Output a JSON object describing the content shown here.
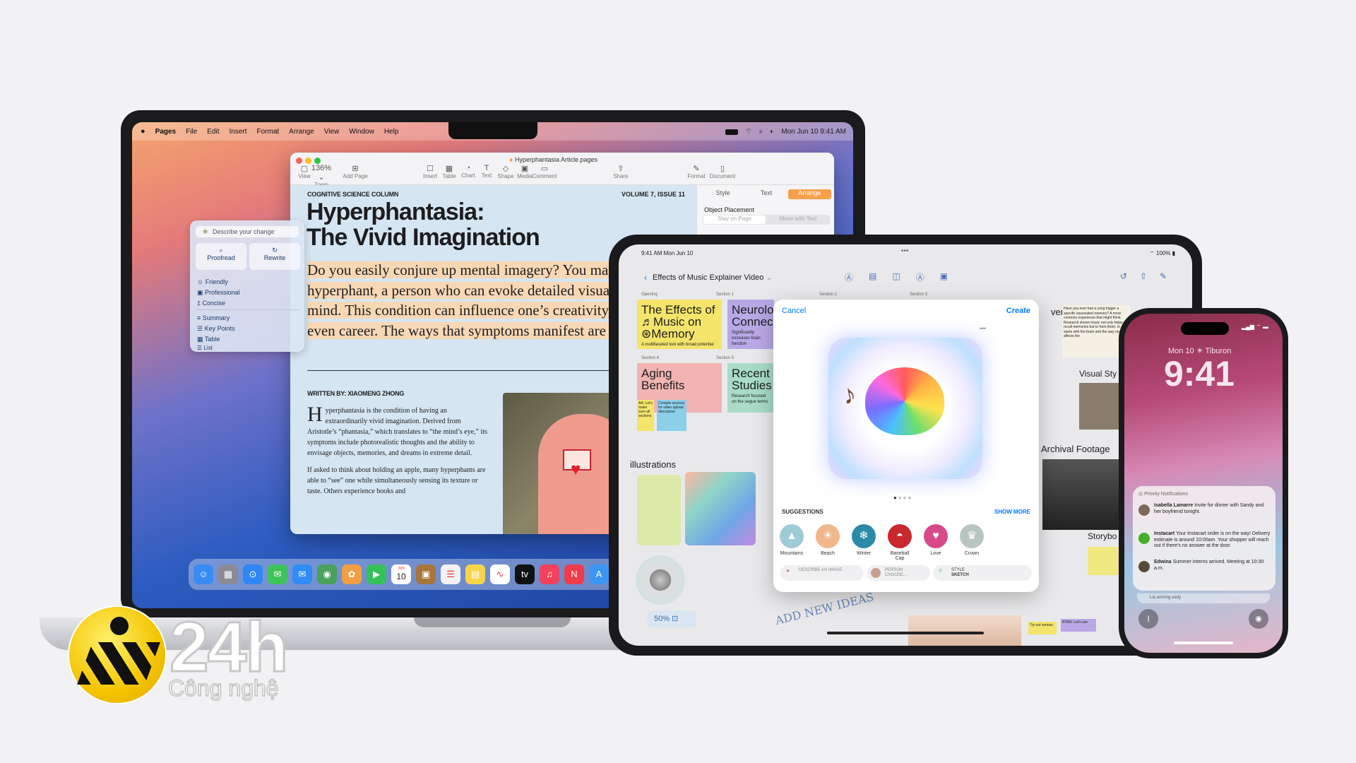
{
  "mac": {
    "menubar": {
      "app": "Pages",
      "items": [
        "File",
        "Edit",
        "Insert",
        "Format",
        "Arrange",
        "View",
        "Window",
        "Help"
      ],
      "datetime": "Mon Jun 10  9:41 AM"
    },
    "pages": {
      "filename": "Hyperphantasia Article.pages",
      "toolbar": [
        {
          "icon": "▢",
          "label": "View"
        },
        {
          "icon": "136% ⌄",
          "label": "Zoom"
        },
        {
          "icon": "⊞",
          "label": "Add Page"
        },
        {
          "icon": "☐",
          "label": "Insert"
        },
        {
          "icon": "▦",
          "label": "Table"
        },
        {
          "icon": "◔",
          "label": "Chart"
        },
        {
          "icon": "T",
          "label": "Text"
        },
        {
          "icon": "◇",
          "label": "Shape"
        },
        {
          "icon": "▣",
          "label": "Media"
        },
        {
          "icon": "▭",
          "label": "Comment"
        },
        {
          "icon": "⇧",
          "label": "Share"
        },
        {
          "icon": "✎",
          "label": "Format"
        },
        {
          "icon": "▯",
          "label": "Document"
        }
      ],
      "inspector": {
        "tabs": [
          "Style",
          "Text",
          "Arrange"
        ],
        "active_tab": "Arrange",
        "section": "Object Placement",
        "options": [
          "Stay on Page",
          "Move with Text"
        ]
      },
      "doc": {
        "column": "COGNITIVE SCIENCE COLUMN",
        "issue": "VOLUME 7, ISSUE 11",
        "title_line1": "Hyperphantasia:",
        "title_line2": "The Vivid Imagination",
        "lede": "Do you easily conjure up mental imagery? You may be a hyperphant, a person who can evoke detailed visuals in their mind. This condition can influence one’s creativity, memory, and even career. The ways that symptoms manifest are astonishing.",
        "byline": "WRITTEN BY: XIAOMENG ZHONG",
        "dropcap": "H",
        "para1": "yperphantasia is the condition of having an extraordinarily vivid imagination. Derived from Aristotle’s “phantasia,” which translates to “the mind’s eye,” its symptoms include photorealistic thoughts and the ability to envisage objects, memories, and dreams in extreme detail.",
        "para2": "If asked to think about holding an apple, many hyperphants are able to “see” one while simultaneously sensing its texture or taste. Others experience books and"
      }
    },
    "writing_tools": {
      "prompt": "Describe your change",
      "buttons": [
        {
          "icon": "⌕",
          "label": "Proofread"
        },
        {
          "icon": "↻",
          "label": "Rewrite"
        }
      ],
      "tones": [
        {
          "icon": "☺",
          "label": "Friendly"
        },
        {
          "icon": "▣",
          "label": "Professional"
        },
        {
          "icon": "‡",
          "label": "Concise"
        }
      ],
      "formats": [
        {
          "icon": "≡",
          "label": "Summary"
        },
        {
          "icon": "☰",
          "label": "Key Points"
        },
        {
          "icon": "▦",
          "label": "Table"
        },
        {
          "icon": "☰",
          "label": "List"
        }
      ]
    },
    "dock": [
      {
        "icon": "☺",
        "color": "#3a8cf5",
        "name": "finder"
      },
      {
        "icon": "▦",
        "color": "#8b8b96",
        "name": "launchpad"
      },
      {
        "icon": "⊙",
        "color": "#2f86f5",
        "name": "safari"
      },
      {
        "icon": "✉",
        "color": "#3dc35a",
        "name": "messages"
      },
      {
        "icon": "✉",
        "color": "#2f8df5",
        "name": "mail"
      },
      {
        "icon": "◉",
        "color": "#4aa25a",
        "name": "maps"
      },
      {
        "icon": "✿",
        "color": "#f0a040",
        "name": "photos"
      },
      {
        "icon": "▶",
        "color": "#34c15a",
        "name": "facetime"
      },
      {
        "icon": "10",
        "color": "#ffffff",
        "name": "calendar"
      },
      {
        "icon": "▣",
        "color": "#a8753a",
        "name": "contacts"
      },
      {
        "icon": "☰",
        "color": "#f2f2f2",
        "name": "reminders"
      },
      {
        "icon": "▤",
        "color": "#f7d54a",
        "name": "notes"
      },
      {
        "icon": "∿",
        "color": "#ffffff",
        "name": "freeform"
      },
      {
        "icon": "tv",
        "color": "#111111",
        "name": "tv"
      },
      {
        "icon": "♫",
        "color": "#f4405c",
        "name": "music"
      },
      {
        "icon": "N",
        "color": "#ef3b4a",
        "name": "news"
      },
      {
        "icon": "A",
        "color": "#3a95f5",
        "name": "keynote"
      }
    ],
    "dock_calendar_month": "JUN"
  },
  "ipad": {
    "status": {
      "time": "9:41 AM  Mon Jun 10",
      "battery": "100%"
    },
    "board_title": "Effects of Music Explainer Video",
    "section_labels": [
      "Opening",
      "Section 1",
      "Section 2",
      "Section 3",
      "Section 4",
      "Section 5"
    ],
    "stickies": [
      {
        "title": "The Effects of ♬Music on ⊛Memory",
        "note": "A multifaceted tool with broad potential",
        "color": "#f4e46a"
      },
      {
        "title": "Neurolog Connect",
        "note": "Significantly increases brain function",
        "color": "#b8a8e6"
      },
      {
        "title": "Aging Benefits",
        "note": "",
        "color": "#f2b3b3"
      },
      {
        "title": "Recent Studies",
        "note": "Research focused on the segue terms",
        "color": "#a8dcc7"
      }
    ],
    "small_notes": [
      "AA: Let's make sure all sections",
      "Compile sources for video upload description"
    ],
    "illustrations_label": "illustrations",
    "right_labels": {
      "side_text": "ver",
      "visual": "Visual Sty",
      "archival": "Archival Footage",
      "story": "Storybo"
    },
    "right_note": "Have you ever had a song trigger a specific associated memory? A more common experience that might think. Research shows music not only helps to recall memories but to form them. In all starts with the brain and the way music affects the",
    "zoom": "50%",
    "annotation": "ADD NEW IDEAS",
    "bottom_notes": [
      "Try out various",
      "RYAN: Let's use"
    ],
    "playground": {
      "cancel": "Cancel",
      "create": "Create",
      "more": "•••",
      "suggestions_label": "SUGGESTIONS",
      "show_more": "SHOW MORE",
      "suggestions": [
        {
          "label": "Mountains",
          "icon": "▲",
          "color": "#9fcbd6"
        },
        {
          "label": "Beach",
          "icon": "☀",
          "color": "#f0b88a"
        },
        {
          "label": "Winter",
          "icon": "❄",
          "color": "#2a8aa8"
        },
        {
          "label": "Baseball Cap",
          "icon": "◓",
          "color": "#c8282e"
        },
        {
          "label": "Love",
          "icon": "♥",
          "color": "#d64a8a"
        },
        {
          "label": "Crown",
          "icon": "♛",
          "color": "#b9c5c0"
        }
      ],
      "pills": [
        {
          "text": "DESCRIBE AN IMAGE",
          "sub": ""
        },
        {
          "text": "PERSON",
          "sub": "CHOOSE..."
        },
        {
          "text": "STYLE",
          "sub": "SKETCH"
        }
      ]
    }
  },
  "iphone": {
    "date": "Mon 10 ☀ Tiburon",
    "time": "9:41",
    "notif_header": "Priority Notifications",
    "notifications": [
      {
        "who": "Isabella Lamarre",
        "text": "Invite for dinner with Sandy and her boyfriend tonight.",
        "color": "#7d6a5a"
      },
      {
        "who": "Instacart",
        "text": "Your Instacart order is on the way! Delivery estimate is around 10:00am. Your shopper will reach out if there's no answer at the door.",
        "color": "#43b02a"
      },
      {
        "who": "Edwina",
        "text": "Summer interns arrived. Meeting at 10:30 a.m.",
        "color": "#5a4a3a"
      }
    ],
    "bottom_notif": "Lia arriving early"
  },
  "watermark": {
    "main": "24h",
    "sub": "Công nghệ"
  }
}
